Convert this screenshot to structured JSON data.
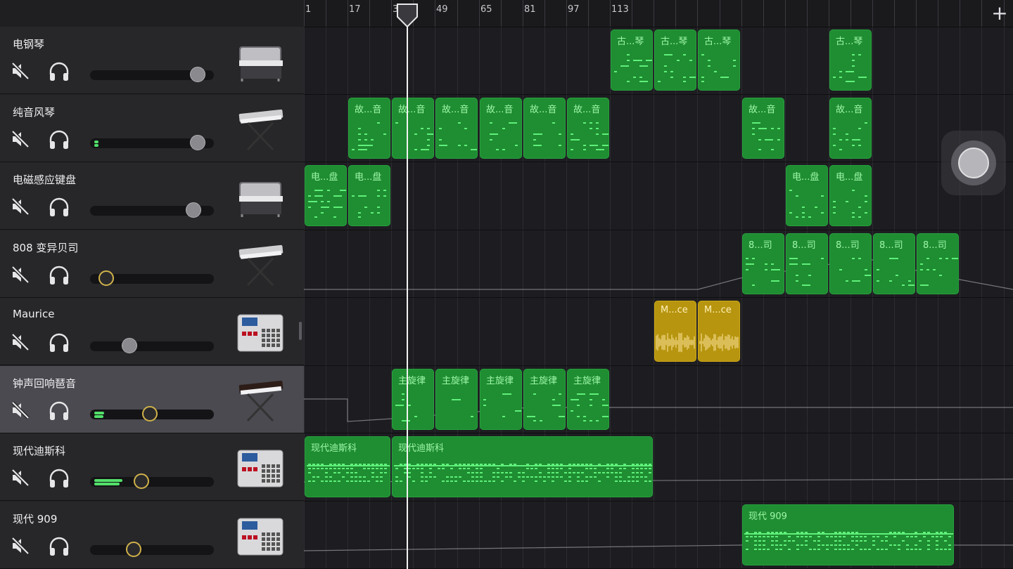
{
  "ruler": {
    "bars": [
      "1",
      "17",
      "33",
      "49",
      "65",
      "81",
      "97",
      "113"
    ],
    "add_label": "+"
  },
  "tracks": [
    {
      "name": "电钢琴",
      "volume": 0.93,
      "level": 0,
      "instrument": "electric-piano-icon"
    },
    {
      "name": "纯音风琴",
      "volume": 0.93,
      "level": 0.03,
      "instrument": "keyboard-stand-icon"
    },
    {
      "name": "电磁感应键盘",
      "volume": 0.89,
      "level": 0,
      "instrument": "electric-piano-icon"
    },
    {
      "name": "808 变异贝司",
      "volume": 0.07,
      "level": 0,
      "instrument": "keyboard-stand-icon"
    },
    {
      "name": "Maurice",
      "volume": 0.29,
      "level": 0,
      "instrument": "drum-machine-icon"
    },
    {
      "name": "钟声回响琶音",
      "volume": 0.48,
      "level": 0.08,
      "instrument": "synth-stand-icon"
    },
    {
      "name": "现代迪斯科",
      "volume": 0.4,
      "level": 0.23,
      "instrument": "drum-machine-icon"
    },
    {
      "name": "现代 909",
      "volume": 0.33,
      "level": 0,
      "instrument": "drum-machine-icon"
    }
  ],
  "regions": [
    {
      "track": 0,
      "label": "古...琴",
      "type": "midi"
    },
    {
      "track": 0,
      "label": "古...琴",
      "type": "midi"
    },
    {
      "track": 0,
      "label": "古...琴",
      "type": "midi"
    },
    {
      "track": 0,
      "label": "古...琴",
      "type": "midi"
    },
    {
      "track": 1,
      "label": "故...音",
      "type": "midi"
    },
    {
      "track": 1,
      "label": "故...音",
      "type": "midi"
    },
    {
      "track": 1,
      "label": "故...音",
      "type": "midi"
    },
    {
      "track": 1,
      "label": "故...音",
      "type": "midi"
    },
    {
      "track": 1,
      "label": "故...音",
      "type": "midi"
    },
    {
      "track": 1,
      "label": "故...音",
      "type": "midi"
    },
    {
      "track": 1,
      "label": "故...音",
      "type": "midi"
    },
    {
      "track": 1,
      "label": "故...音",
      "type": "midi"
    },
    {
      "track": 2,
      "label": "电...盘",
      "type": "midi"
    },
    {
      "track": 2,
      "label": "电...盘",
      "type": "midi"
    },
    {
      "track": 2,
      "label": "电...盘",
      "type": "midi"
    },
    {
      "track": 2,
      "label": "电...盘",
      "type": "midi"
    },
    {
      "track": 3,
      "label": "8...司",
      "type": "midi"
    },
    {
      "track": 3,
      "label": "8...司",
      "type": "midi"
    },
    {
      "track": 3,
      "label": "8...司",
      "type": "midi"
    },
    {
      "track": 3,
      "label": "8...司",
      "type": "midi"
    },
    {
      "track": 3,
      "label": "8...司",
      "type": "midi"
    },
    {
      "track": 4,
      "label": "M...ce",
      "type": "audio"
    },
    {
      "track": 4,
      "label": "M...ce",
      "type": "audio"
    },
    {
      "track": 5,
      "label": "主旋律",
      "type": "midi"
    },
    {
      "track": 5,
      "label": "主旋律",
      "type": "midi"
    },
    {
      "track": 5,
      "label": "主旋律",
      "type": "midi"
    },
    {
      "track": 5,
      "label": "主旋律",
      "type": "midi"
    },
    {
      "track": 5,
      "label": "主旋律",
      "type": "midi"
    },
    {
      "track": 6,
      "label": "现代迪斯科",
      "type": "midi"
    },
    {
      "track": 6,
      "label": "现代迪斯科",
      "type": "midi"
    },
    {
      "track": 7,
      "label": "现代 909",
      "type": "midi"
    }
  ],
  "colors": {
    "midi_region": "#1f8d32",
    "audio_region": "#b7950f",
    "note": "#5ff07a",
    "selected_track": "#4a4a50"
  }
}
